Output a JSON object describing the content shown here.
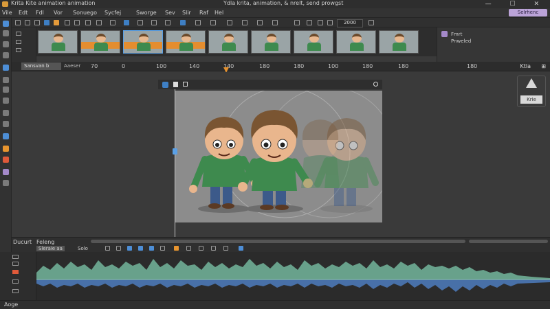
{
  "window": {
    "title_left": "Krita Kite animation animation",
    "title_center": "Ydla   krita, animation, & nrelt, send prowgst"
  },
  "menubar": {
    "items": [
      "Vile",
      "Edt",
      "Fdl",
      "Vor",
      "Sonuego",
      "Sycfej",
      "Sworge",
      "Sev",
      "Slir",
      "Raf",
      "Hel"
    ],
    "badge": "Selrhenc"
  },
  "toolbar": {
    "counter": "2000"
  },
  "right_panel": {
    "line1": "Fmrt",
    "line2": "Pnweled"
  },
  "ruler": {
    "layer_tab": "Sansvan b",
    "label2": "Aaeser",
    "ticks": [
      "70",
      "0",
      "100",
      "140",
      "140",
      "180",
      "180",
      "100",
      "180",
      "180",
      "180"
    ],
    "keyframe_label": "Ktla",
    "keyframe_icon": "⊞"
  },
  "side_badge": {
    "label": "Krie"
  },
  "timeline": {
    "label1": "Ducurt",
    "label2": "Feleng",
    "layer_tab": "Sleraie aa",
    "label3": "Solo"
  },
  "bottom_bar": {
    "label": "Aoge"
  },
  "colors": {
    "accent_orange": "#e5912e",
    "accent_blue": "#3e7fc4",
    "wave_green": "#6fae96",
    "wave_blue": "#4b78b6",
    "shirt_green": "#3e8a4e"
  },
  "icons": {
    "window_controls": "—  ☐  ✕"
  }
}
